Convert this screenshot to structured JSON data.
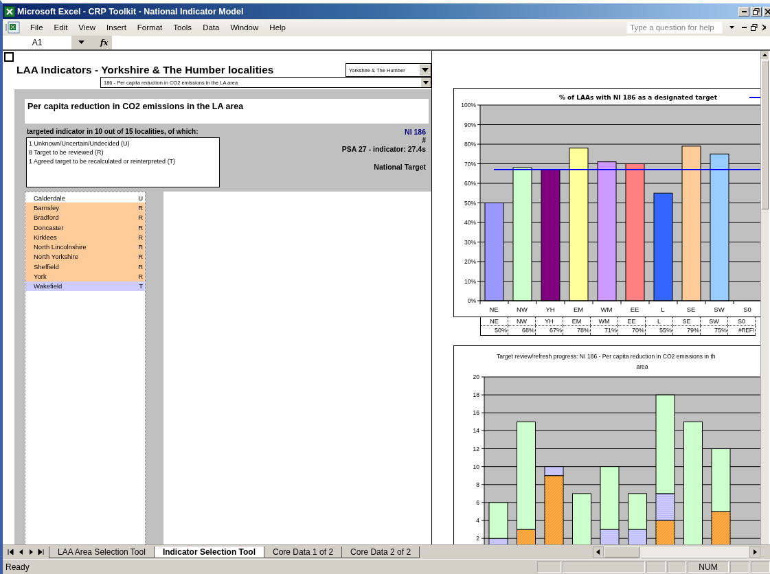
{
  "window": {
    "title": "Microsoft Excel - CRP Toolkit - National Indicator Model"
  },
  "menu": [
    "File",
    "Edit",
    "View",
    "Insert",
    "Format",
    "Tools",
    "Data",
    "Window",
    "Help"
  ],
  "help_box": {
    "placeholder": "Type a question for help"
  },
  "formula_bar": {
    "name_box": "A1",
    "fx": "fx"
  },
  "sheet": {
    "title": "LAA Indicators - Yorkshire & The Humber localities",
    "region_dropdown": "Yorkshire & The Humber",
    "indicator_dropdown": "186 - Per capita reduction in CO2 emissions in the LA area",
    "indicator_title": "Per capita reduction in CO2 emissions in the LA area",
    "summary": "targeted indicator in 10 out of 15 localities, of which:",
    "breakdown": [
      "1 Unknown/Uncertain/Undecided (U)",
      "8 Target to be reviewed (R)",
      "1 Agreed target to be recalculated or reinterpreted (T)"
    ],
    "code": "NI 186",
    "mark": "#",
    "psa": "PSA 27 - indicator: 27.4s",
    "target_type": "National Target",
    "localities": [
      {
        "name": "Calderdale",
        "status": "U",
        "color": "#ffffff"
      },
      {
        "name": "Barnsley",
        "status": "R",
        "color": "#ffcc99"
      },
      {
        "name": "Bradford",
        "status": "R",
        "color": "#ffcc99"
      },
      {
        "name": "Doncaster",
        "status": "R",
        "color": "#ffcc99"
      },
      {
        "name": "Kirklees",
        "status": "R",
        "color": "#ffcc99"
      },
      {
        "name": "North Lincolnshire",
        "status": "R",
        "color": "#ffcc99"
      },
      {
        "name": "North Yorkshire",
        "status": "R",
        "color": "#ffcc99"
      },
      {
        "name": "Sheffield",
        "status": "R",
        "color": "#ffcc99"
      },
      {
        "name": "York",
        "status": "R",
        "color": "#ffcc99"
      },
      {
        "name": "Wakefield",
        "status": "T",
        "color": "#ccccff"
      }
    ]
  },
  "charts": [
    {
      "chart_data": {
        "type": "bar",
        "title": "% of LAAs with NI 186 as a designated target",
        "categories": [
          "NE",
          "NW",
          "YH",
          "EM",
          "WM",
          "EE",
          "L",
          "SE",
          "SW",
          "S0"
        ],
        "series": [
          {
            "values": [
              50,
              68,
              67,
              78,
              71,
              70,
              55,
              79,
              75,
              null
            ],
            "colors": [
              "#9999ff",
              "#ccffcc",
              "#800080",
              "#ffff99",
              "#cc99ff",
              "#ff8080",
              "#3366ff",
              "#ffcc99",
              "#99ccff",
              null
            ]
          }
        ],
        "grid": true,
        "ylim": [
          0,
          100
        ],
        "yticks": [
          {
            "value": 0,
            "label": "0%"
          },
          {
            "value": 10,
            "label": "10%"
          },
          {
            "value": 20,
            "label": "20%"
          },
          {
            "value": 30,
            "label": "30%"
          },
          {
            "value": 40,
            "label": "40%"
          },
          {
            "value": 50,
            "label": "50%"
          },
          {
            "value": 60,
            "label": "60%"
          },
          {
            "value": 70,
            "label": "70%"
          },
          {
            "value": 80,
            "label": "80%"
          },
          {
            "value": 90,
            "label": "90%"
          },
          {
            "value": 100,
            "label": "100%"
          }
        ],
        "ref_lines": [
          {
            "axis": "y",
            "value": 67,
            "color": "#0000ff"
          }
        ]
      },
      "data_table": {
        "headers": [
          "NE",
          "NW",
          "YH",
          "EM",
          "WM",
          "EE",
          "L",
          "SE",
          "SW",
          "S0"
        ],
        "values": [
          "50%",
          "68%",
          "67%",
          "78%",
          "71%",
          "70%",
          "55%",
          "79%",
          "75%",
          "#REF!"
        ]
      }
    },
    {
      "chart_data": {
        "type": "bar",
        "stacked": true,
        "title": "Target review/refresh progress: NI 186 - Per capita reduction in CO2 emissions in th area",
        "series": [
          {
            "color": "#ff9933",
            "values": [
              0,
              3,
              9,
              0,
              0,
              0,
              4,
              0,
              5,
              0
            ]
          },
          {
            "color": "#ccccff",
            "values": [
              2,
              0,
              1,
              0,
              3,
              3,
              3,
              0,
              0,
              0
            ]
          },
          {
            "color": "#ccffcc",
            "values": [
              4,
              12,
              0,
              7,
              7,
              4,
              11,
              15,
              7,
              0
            ]
          }
        ],
        "grid": true,
        "ylim": [
          0,
          20
        ],
        "yticks": [
          2,
          4,
          6,
          8,
          10,
          12,
          14,
          16,
          18,
          20
        ]
      }
    }
  ],
  "sheet_tabs": [
    {
      "label": "LAA Area Selection Tool",
      "selected": false
    },
    {
      "label": "Indicator Selection Tool",
      "selected": true
    },
    {
      "label": "Core Data 1 of 2",
      "selected": false
    },
    {
      "label": "Core Data 2 of 2",
      "selected": false
    }
  ],
  "status_bar": {
    "text": "Ready",
    "indicators": [
      "NUM"
    ]
  }
}
